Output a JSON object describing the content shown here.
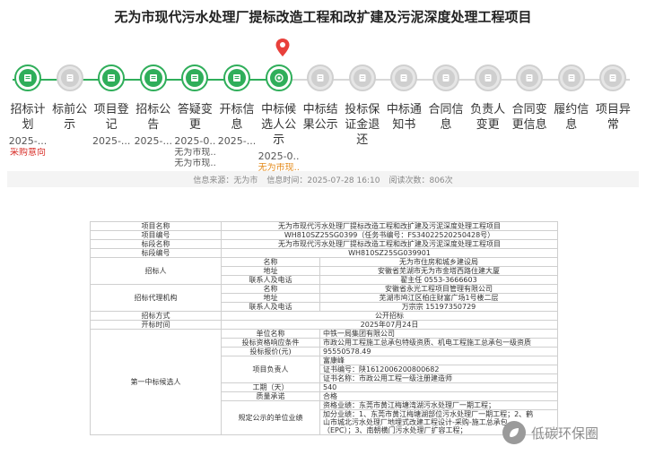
{
  "page": {
    "title": "无为市现代污水处理厂提标改造工程和改扩建及污泥深度处理工程项目"
  },
  "steps": [
    {
      "label": "招标计划",
      "date": "2025-...",
      "sub": "采购意向",
      "sub_color": "red",
      "state": "done"
    },
    {
      "label": "标前公示",
      "date": "",
      "sub": "",
      "state": "todo"
    },
    {
      "label": "项目登记",
      "date": "2025-...",
      "sub": "",
      "state": "done"
    },
    {
      "label": "招标公告",
      "date": "2025-...",
      "sub": "",
      "state": "done"
    },
    {
      "label": "答疑变更",
      "date": "2025-0...",
      "sub": "无为市现...",
      "sub2": "无为市现...",
      "state": "done"
    },
    {
      "label": "开标信息",
      "date": "2025-...",
      "sub": "",
      "state": "done"
    },
    {
      "label": "中标候选人公示",
      "date": "2025-0...",
      "sub": "无为市现...",
      "sub_color": "orange",
      "state": "current"
    },
    {
      "label": "中标结果公示",
      "date": "",
      "sub": "",
      "state": "todo"
    },
    {
      "label": "投标保证金退还",
      "date": "",
      "sub": "",
      "state": "todo"
    },
    {
      "label": "中标通知书",
      "date": "",
      "sub": "",
      "state": "todo"
    },
    {
      "label": "合同信息",
      "date": "",
      "sub": "",
      "state": "todo"
    },
    {
      "label": "负责人变更",
      "date": "",
      "sub": "",
      "state": "todo"
    },
    {
      "label": "合同变更信息",
      "date": "",
      "sub": "",
      "state": "todo"
    },
    {
      "label": "履约信息",
      "date": "",
      "sub": "",
      "state": "todo"
    },
    {
      "label": "项目异常",
      "date": "",
      "sub": "",
      "state": "todo"
    }
  ],
  "meta": {
    "source": "信息来源：无为市",
    "time": "信息时间：2025-07-28 16:10",
    "views": "阅读次数：806次"
  },
  "table": {
    "project_name_k": "项目名称",
    "project_name_v": "无为市现代污水处理厂提标改造工程和改扩建及污泥深度处理工程项目",
    "project_no_k": "项目编号",
    "project_no_v": "WH810SZ25SG0399（任务书编号：FS34022520250428号）",
    "section_name_k": "标段名称",
    "section_name_v": "无为市现代污水处理厂提标改造工程和改扩建及污泥深度处理工程项目",
    "section_no_k": "标段编号",
    "section_no_v": "WH810SZ25SG039901",
    "tenderer_k": "招标人",
    "name_k": "名称",
    "tenderer_name": "无为市住房和城乡建设局",
    "addr_k": "地址",
    "tenderer_addr": "安徽省芜湖市无为市金塔西路住建大厦",
    "contact_k": "联系人及电话",
    "tenderer_contact": "翟主任 0553-3666603",
    "agency_k": "招标代理机构",
    "agency_name": "安徽省永光工程项目管理有限公司",
    "agency_addr": "芜湖市鸠江区柏庄财富广场1号楼二层",
    "agency_contact": "万宗宗 15197350729",
    "method_k": "招标方式",
    "method_v": "公开招标",
    "open_time_k": "开标时间",
    "open_time_v": "2025年07月24日",
    "first_k": "第一中标候选人",
    "unit_name_k": "单位名称",
    "unit_name_v": "中铁一局集团有限公司",
    "qual_k": "投标资格响应条件",
    "qual_v": "市政公用工程施工总承包特级资质、机电工程施工总承包一级资质",
    "price_k": "投标报价(元)",
    "price_v": "95550578.49",
    "pm_k": "项目负责人",
    "pm_v1": "富康峰",
    "pm_v2": "证书编号：陕1612006200800682",
    "pm_v3": "证书名称：市政公用工程一级注册建造师",
    "period_k": "工期（天）",
    "period_v": "540",
    "quality_k": "质量承诺",
    "quality_v": "合格",
    "perf_k": "规定公示的单位业绩",
    "perf_v1": "资格业绩：东莞市黄江梅塘湾湖污水处理厂一期工程；",
    "perf_v2": "加分业绩：1、东莞市黄江梅塘湖部位污水处理厂一期工程；2、鹤",
    "perf_v3": "山市城北污水处理厂地埋式改建工程设计-采购-施工总承包",
    "perf_v4": "（EPC）；3、南朝横门污水处理厂扩容工程；"
  },
  "watermark": {
    "text": "低碳环保圈"
  },
  "colors": {
    "accent": "#2fae5a",
    "pending": "#cfcfcf",
    "pin": "#e8403b"
  }
}
